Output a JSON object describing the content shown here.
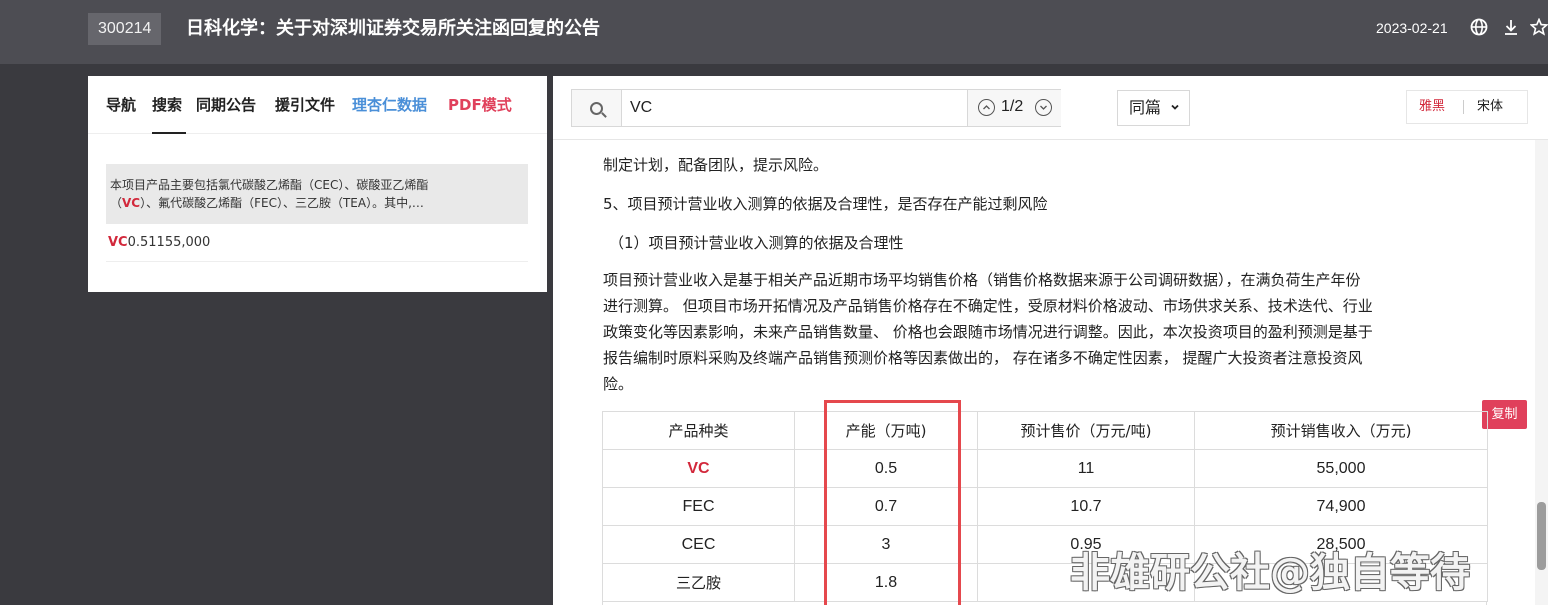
{
  "header": {
    "stock_code": "300214",
    "title": "日科化学：关于对深圳证券交易所关注函回复的公告",
    "date": "2023-02-21",
    "icons": [
      "globe-icon",
      "download-icon",
      "star-icon"
    ]
  },
  "left_panel": {
    "tabs": [
      "导航",
      "搜索",
      "同期公告",
      "援引文件",
      "理杏仁数据",
      "PDF模式"
    ],
    "active_tab": "搜索",
    "results": [
      {
        "line1": "本项目产品主要包括氯代碳酸乙烯酯（CEC）、碳酸亚乙烯酯",
        "line2_pre": "（",
        "match": "VC",
        "line2_post": "）、氟代碳酸乙烯酯（FEC）、三乙胺（TEA）。其中,…"
      },
      {
        "match": "VC",
        "rest": "0.51155,000"
      }
    ]
  },
  "toolbar": {
    "search_value": "VC",
    "match_count": "1/2",
    "prev_symbol": "⌃",
    "next_symbol": "⌄",
    "scope": "同篇",
    "font_options": [
      "雅黑",
      "宋体"
    ],
    "active_font": "雅黑"
  },
  "document": {
    "line_prev": "制定计划，配备团队，提示风险。",
    "heading": "5、项目预计营业收入测算的依据及合理性，是否存在产能过剩风险",
    "subheading": "（1）项目预计营业收入测算的依据及合理性",
    "body": [
      "项目预计营业收入是基于相关产品近期市场平均销售价格（销售价格数据来源于公司调研数据），在满负荷生产年份",
      "进行测算。 但项目市场开拓情况及产品销售价格存在不确定性，受原材料价格波动、市场供求关系、技术迭代、行业",
      "政策变化等因素影响，未来产品销售数量、 价格也会跟随市场情况进行调整。因此，本次投资项目的盈利预测是基于",
      "报告编制时原料采购及终端产品销售预测价格等因素做出的， 存在诸多不确定性因素， 提醒广大投资者注意投资风",
      "险。"
    ],
    "copy_label": "复制",
    "table": {
      "headers": [
        "产品种类",
        "产能（万吨)",
        "预计售价（万元/吨)",
        "预计销售收入（万元)"
      ],
      "rows": [
        [
          "VC",
          "0.5",
          "11",
          "55,000"
        ],
        [
          "FEC",
          "0.7",
          "10.7",
          "74,900"
        ],
        [
          "CEC",
          "3",
          "0.95",
          "28,500"
        ],
        [
          "三乙胺",
          "1.8",
          "",
          ""
        ]
      ]
    }
  },
  "watermark": "非雄研公社@独自等待"
}
